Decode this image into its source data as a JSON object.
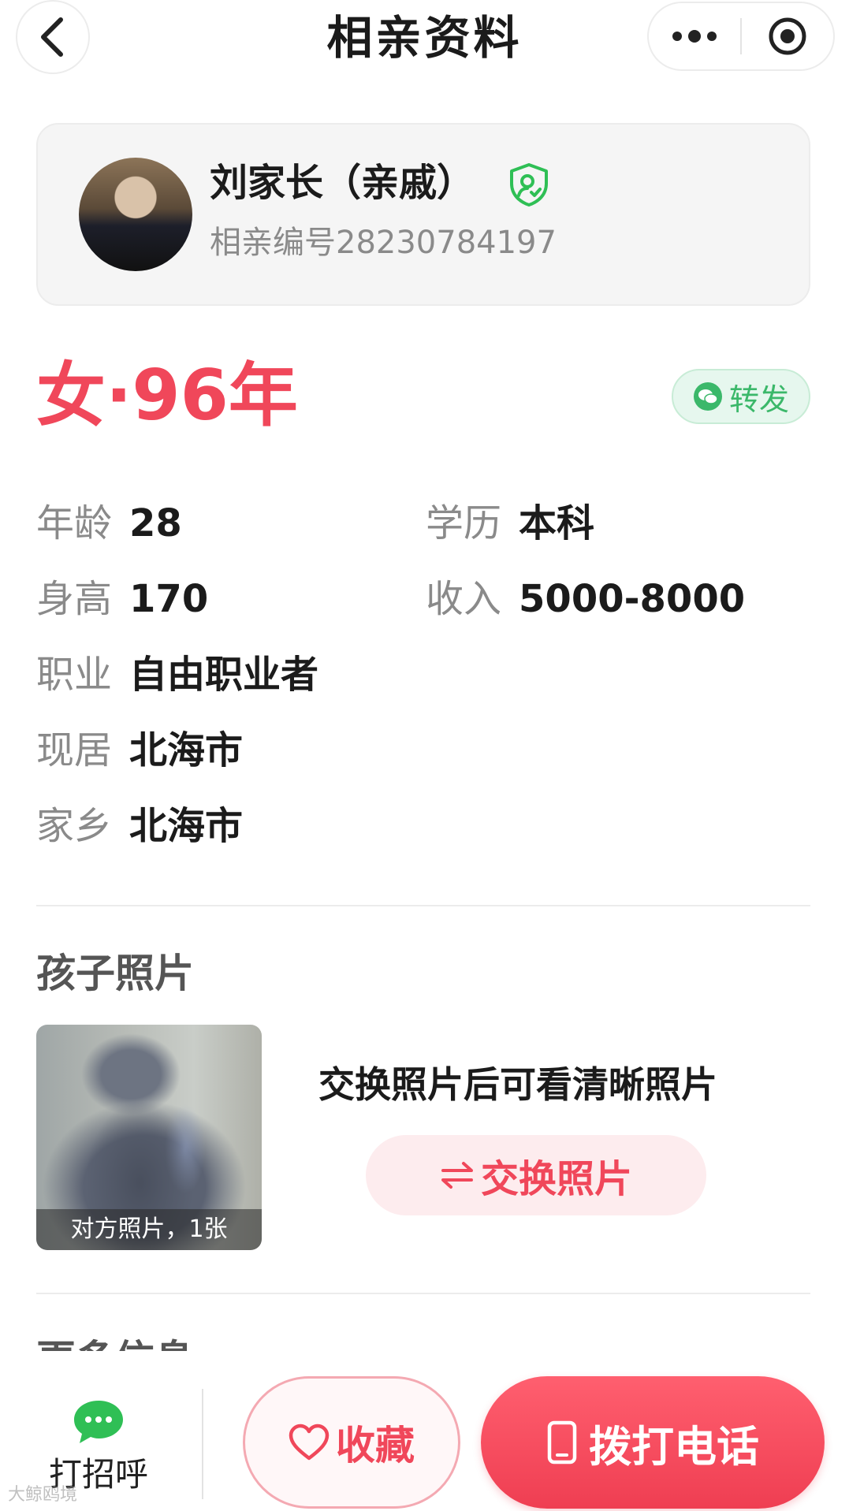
{
  "nav": {
    "title": "相亲资料"
  },
  "profile": {
    "name": "刘家长（亲戚）",
    "id_text": "相亲编号28230784197"
  },
  "headline": "女·96年",
  "share": {
    "label": "转发"
  },
  "info": {
    "age": {
      "label": "年龄",
      "value": "28"
    },
    "education": {
      "label": "学历",
      "value": "本科"
    },
    "height": {
      "label": "身高",
      "value": "170"
    },
    "income": {
      "label": "收入",
      "value": "5000-8000"
    },
    "job": {
      "label": "职业",
      "value": "自由职业者"
    },
    "residence": {
      "label": "现居",
      "value": "北海市"
    },
    "hometown": {
      "label": "家乡",
      "value": "北海市"
    }
  },
  "photos": {
    "section_title": "孩子照片",
    "caption": "对方照片，1张",
    "hint": "交换照片后可看清晰照片",
    "exchange_label": "交换照片"
  },
  "more": {
    "title": "更多信息"
  },
  "bottom": {
    "greet_label": "打招呼",
    "fav_label": "收藏",
    "call_label": "拨打电话"
  },
  "watermark": "大鲸鸥境",
  "colors": {
    "accent": "#f0475a",
    "verified": "#2fbf55",
    "wechat": "#3bb86a"
  }
}
